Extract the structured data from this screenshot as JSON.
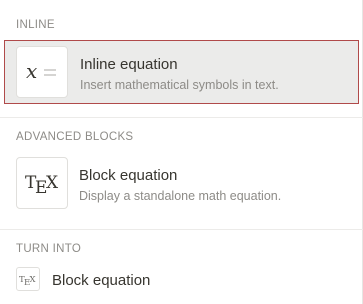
{
  "sections": {
    "inline": {
      "label": "INLINE",
      "item": {
        "title": "Inline equation",
        "description": "Insert mathematical symbols in text.",
        "icon": "x-equation-icon"
      }
    },
    "advanced": {
      "label": "ADVANCED BLOCKS",
      "item": {
        "title": "Block equation",
        "description": "Display a standalone math equation.",
        "icon": "tex-icon"
      }
    },
    "turn_into": {
      "label": "TURN INTO",
      "item": {
        "title": "Block equation",
        "icon": "tex-icon"
      }
    }
  },
  "colors": {
    "selected_bg": "#ebebea",
    "selected_border": "#b04a4a",
    "text": "#37352f",
    "muted": "#8d8b87"
  }
}
